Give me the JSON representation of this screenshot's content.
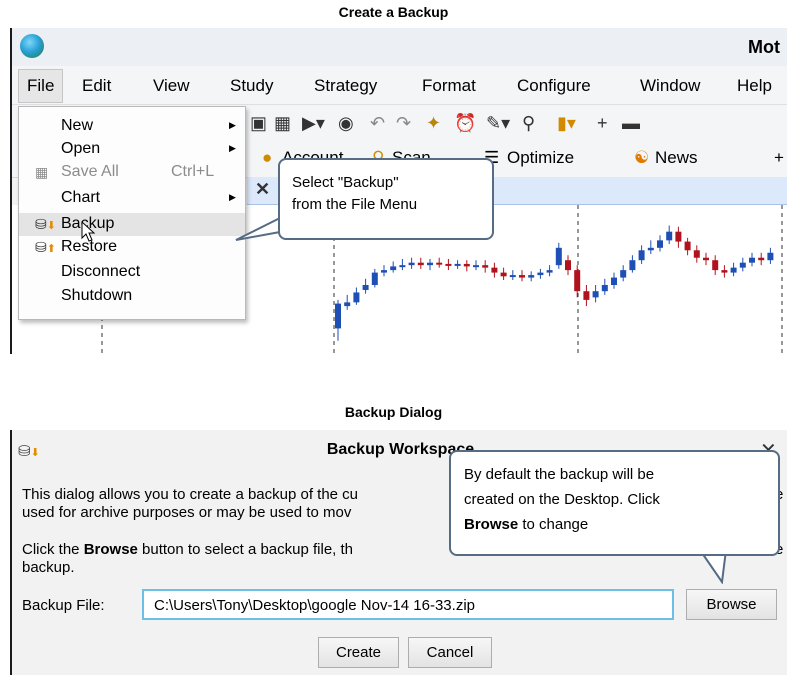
{
  "captions": {
    "top": "Create a Backup",
    "bottom": "Backup Dialog"
  },
  "app": {
    "title": "Mot"
  },
  "menubar": [
    "File",
    "Edit",
    "View",
    "Study",
    "Strategy",
    "Format",
    "Configure",
    "Window",
    "Help"
  ],
  "toolbar2": {
    "account": "Account",
    "scan": "Scan",
    "optimize": "Optimize",
    "news": "News"
  },
  "file_menu": {
    "items": [
      {
        "label": "New",
        "submenu": true
      },
      {
        "label": "Open",
        "submenu": true
      },
      {
        "label": "Save All",
        "shortcut": "Ctrl+L",
        "disabled": true,
        "icon": "save-all-icon"
      },
      {
        "label": "Chart",
        "submenu": true
      },
      {
        "label": "Backup",
        "highlighted": true,
        "icon": "database-down-icon"
      },
      {
        "label": "Restore",
        "icon": "database-up-icon"
      },
      {
        "label": "Disconnect"
      },
      {
        "label": "Shutdown"
      }
    ]
  },
  "callout1": {
    "line1": "Select \"Backup\"",
    "line2": "from the File Menu"
  },
  "dialog": {
    "title": "Backup Workspace",
    "para1_line1": "This dialog allows you to create a backup of the cu",
    "para1_line1_tail": "e",
    "para1_line2": "used for archive purposes or may be used to mov",
    "para2_pre": "Click the ",
    "para2_bold": "Browse",
    "para2_post": " button to select a backup file, th",
    "para2_tail": "e",
    "para2_line2": "backup.",
    "backup_file_label": "Backup File:",
    "backup_file_value": "C:\\Users\\Tony\\Desktop\\google Nov-14 16-33.zip",
    "browse_label": "Browse",
    "create_label": "Create",
    "cancel_label": "Cancel"
  },
  "callout2": {
    "line1": "By default the backup will be",
    "line2": "created on the Desktop.  Click",
    "line3_bold": "Browse",
    "line3_rest": " to change"
  },
  "chart_candles": [
    {
      "o": 0.15,
      "c": 0.35,
      "h": 0.38,
      "l": 0.05
    },
    {
      "o": 0.33,
      "c": 0.36,
      "h": 0.42,
      "l": 0.3
    },
    {
      "o": 0.36,
      "c": 0.44,
      "h": 0.48,
      "l": 0.34
    },
    {
      "o": 0.46,
      "c": 0.5,
      "h": 0.55,
      "l": 0.43
    },
    {
      "o": 0.5,
      "c": 0.6,
      "h": 0.63,
      "l": 0.48
    },
    {
      "o": 0.6,
      "c": 0.62,
      "h": 0.66,
      "l": 0.57
    },
    {
      "o": 0.62,
      "c": 0.65,
      "h": 0.69,
      "l": 0.6
    },
    {
      "o": 0.65,
      "c": 0.66,
      "h": 0.71,
      "l": 0.62
    },
    {
      "o": 0.66,
      "c": 0.68,
      "h": 0.72,
      "l": 0.63
    },
    {
      "o": 0.68,
      "c": 0.66,
      "h": 0.72,
      "l": 0.63
    },
    {
      "o": 0.66,
      "c": 0.68,
      "h": 0.71,
      "l": 0.62
    },
    {
      "o": 0.68,
      "c": 0.67,
      "h": 0.72,
      "l": 0.64
    },
    {
      "o": 0.67,
      "c": 0.66,
      "h": 0.71,
      "l": 0.62
    },
    {
      "o": 0.66,
      "c": 0.67,
      "h": 0.7,
      "l": 0.63
    },
    {
      "o": 0.67,
      "c": 0.65,
      "h": 0.7,
      "l": 0.61
    },
    {
      "o": 0.65,
      "c": 0.66,
      "h": 0.7,
      "l": 0.62
    },
    {
      "o": 0.66,
      "c": 0.64,
      "h": 0.7,
      "l": 0.6
    },
    {
      "o": 0.64,
      "c": 0.6,
      "h": 0.68,
      "l": 0.56
    },
    {
      "o": 0.6,
      "c": 0.57,
      "h": 0.64,
      "l": 0.54
    },
    {
      "o": 0.57,
      "c": 0.58,
      "h": 0.62,
      "l": 0.54
    },
    {
      "o": 0.58,
      "c": 0.56,
      "h": 0.62,
      "l": 0.53
    },
    {
      "o": 0.56,
      "c": 0.58,
      "h": 0.61,
      "l": 0.53
    },
    {
      "o": 0.58,
      "c": 0.6,
      "h": 0.63,
      "l": 0.55
    },
    {
      "o": 0.6,
      "c": 0.62,
      "h": 0.66,
      "l": 0.57
    },
    {
      "o": 0.66,
      "c": 0.8,
      "h": 0.84,
      "l": 0.63
    },
    {
      "o": 0.7,
      "c": 0.62,
      "h": 0.74,
      "l": 0.58
    },
    {
      "o": 0.62,
      "c": 0.45,
      "h": 0.66,
      "l": 0.4
    },
    {
      "o": 0.45,
      "c": 0.38,
      "h": 0.5,
      "l": 0.33
    },
    {
      "o": 0.4,
      "c": 0.45,
      "h": 0.5,
      "l": 0.36
    },
    {
      "o": 0.45,
      "c": 0.5,
      "h": 0.55,
      "l": 0.42
    },
    {
      "o": 0.5,
      "c": 0.56,
      "h": 0.6,
      "l": 0.47
    },
    {
      "o": 0.56,
      "c": 0.62,
      "h": 0.66,
      "l": 0.53
    },
    {
      "o": 0.62,
      "c": 0.7,
      "h": 0.74,
      "l": 0.6
    },
    {
      "o": 0.7,
      "c": 0.78,
      "h": 0.82,
      "l": 0.67
    },
    {
      "o": 0.78,
      "c": 0.8,
      "h": 0.86,
      "l": 0.75
    },
    {
      "o": 0.8,
      "c": 0.86,
      "h": 0.9,
      "l": 0.77
    },
    {
      "o": 0.86,
      "c": 0.93,
      "h": 0.98,
      "l": 0.83
    },
    {
      "o": 0.93,
      "c": 0.85,
      "h": 0.97,
      "l": 0.8
    },
    {
      "o": 0.85,
      "c": 0.78,
      "h": 0.88,
      "l": 0.74
    },
    {
      "o": 0.78,
      "c": 0.72,
      "h": 0.82,
      "l": 0.68
    },
    {
      "o": 0.72,
      "c": 0.7,
      "h": 0.76,
      "l": 0.66
    },
    {
      "o": 0.7,
      "c": 0.62,
      "h": 0.74,
      "l": 0.58
    },
    {
      "o": 0.62,
      "c": 0.6,
      "h": 0.66,
      "l": 0.56
    },
    {
      "o": 0.6,
      "c": 0.64,
      "h": 0.68,
      "l": 0.57
    },
    {
      "o": 0.64,
      "c": 0.68,
      "h": 0.72,
      "l": 0.61
    },
    {
      "o": 0.68,
      "c": 0.72,
      "h": 0.76,
      "l": 0.65
    },
    {
      "o": 0.72,
      "c": 0.7,
      "h": 0.76,
      "l": 0.66
    },
    {
      "o": 0.7,
      "c": 0.76,
      "h": 0.8,
      "l": 0.67
    }
  ],
  "colors": {
    "up": "#1e4fb5",
    "down": "#b0131d",
    "accent": "#6cc0e8",
    "callout_border": "#566b84"
  }
}
